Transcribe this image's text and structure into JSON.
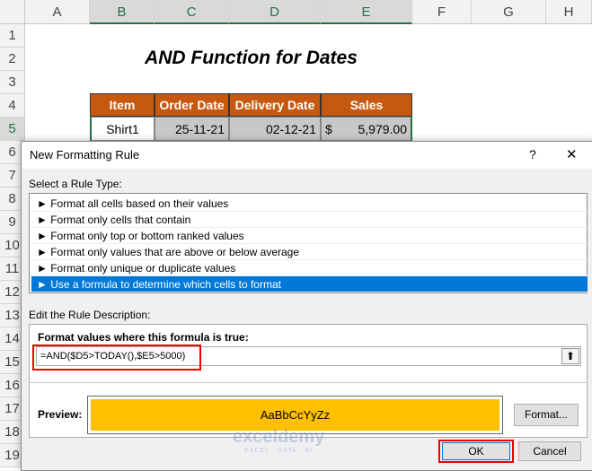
{
  "sheet": {
    "columns": [
      "A",
      "B",
      "C",
      "D",
      "E",
      "F",
      "G",
      "H"
    ],
    "rows": [
      "1",
      "2",
      "3",
      "4",
      "5",
      "6",
      "7",
      "8",
      "9",
      "10",
      "11",
      "12",
      "13",
      "14",
      "15",
      "16",
      "17",
      "18",
      "19"
    ],
    "title": "AND Function for Dates",
    "headers": [
      "Item",
      "Order Date",
      "Delivery Date",
      "Sales"
    ],
    "row5": {
      "item": "Shirt1",
      "order": "25-11-21",
      "delivery": "02-12-21",
      "currency": "$",
      "sales": "5,979.00"
    }
  },
  "dialog": {
    "title": "New Formatting Rule",
    "help": "?",
    "close": "✕",
    "select_label": "Select a Rule Type:",
    "rule_types": [
      "► Format all cells based on their values",
      "► Format only cells that contain",
      "► Format only top or bottom ranked values",
      "► Format only values that are above or below average",
      "► Format only unique or duplicate values",
      "► Use a formula to determine which cells to format"
    ],
    "edit_label": "Edit the Rule Description:",
    "formula_label": "Format values where this formula is true:",
    "formula": "=AND($D5>TODAY(),$E5>5000)",
    "collapse_icon": "⬆",
    "preview_label": "Preview:",
    "preview_text": "AaBbCcYyZz",
    "preview_color": "#ffc000",
    "format_button": "Format...",
    "ok": "OK",
    "cancel": "Cancel"
  },
  "watermark": {
    "name": "exceldemy",
    "tagline": "EXCEL · DATA · BI"
  }
}
